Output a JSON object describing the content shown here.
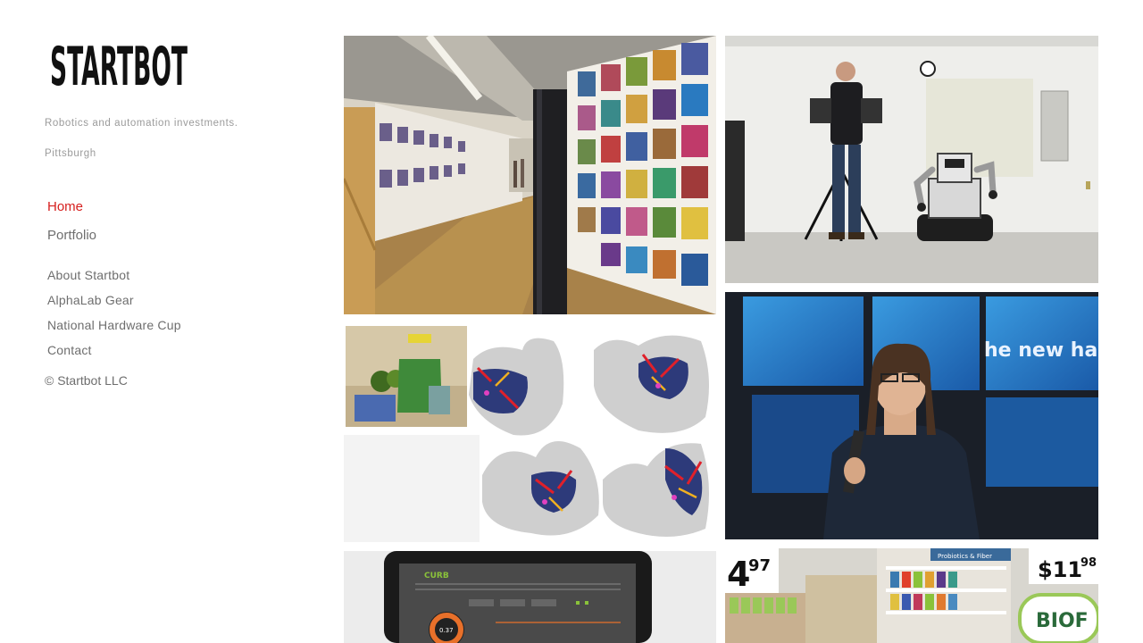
{
  "site": {
    "logo_alt": "STARTBOT",
    "tagline": "Robotics and automation investments.",
    "location": "Pittsburgh"
  },
  "nav": {
    "primary": [
      {
        "label": "Home",
        "active": true
      },
      {
        "label": "Portfolio",
        "active": false
      }
    ],
    "secondary": [
      {
        "label": "About Startbot"
      },
      {
        "label": "AlphaLab Gear"
      },
      {
        "label": "National Hardware Cup"
      },
      {
        "label": "Contact"
      }
    ]
  },
  "footer": {
    "copyright": "© Startbot LLC"
  },
  "gallery": {
    "photo_texts": {
      "speaker_banner": "he new ha",
      "curb_logo": "CURB",
      "gauge_value": "0.37",
      "price_left": "4",
      "price_left_cents": "97",
      "price_right": "$11",
      "price_right_cents": "98",
      "banner_brand": "BIOF",
      "shelf_sign": "Probiotics & Fiber"
    },
    "items": [
      {
        "name": "office-hallway-photo"
      },
      {
        "name": "robot-demo-photo"
      },
      {
        "name": "point-cloud-grasping-photo"
      },
      {
        "name": "speaker-photo"
      },
      {
        "name": "energy-monitor-laptop-photo"
      },
      {
        "name": "pharmacy-aisle-photo"
      }
    ]
  },
  "colors": {
    "accent": "#d6201f",
    "nav_text": "#6e6e6e",
    "muted_text": "#9b9b9b"
  }
}
